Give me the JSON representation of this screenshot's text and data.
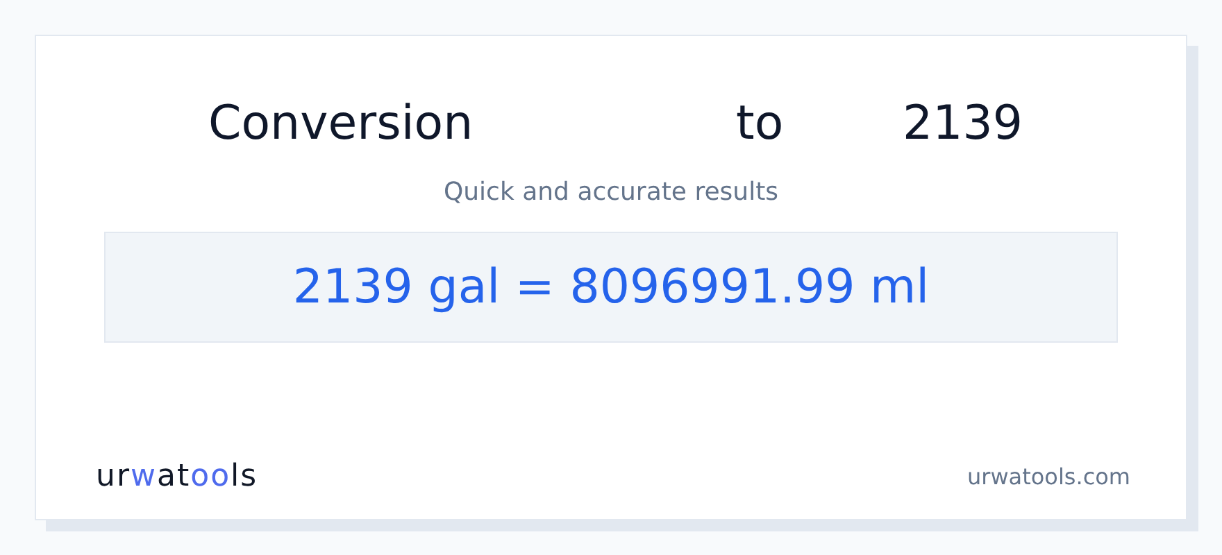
{
  "title": {
    "parts": [
      "Conversion",
      "to",
      "2139"
    ]
  },
  "subtitle": "Quick and accurate results",
  "result": "2139 gal = 8096991.99 ml",
  "logo": [
    {
      "text": "ur",
      "accent": false
    },
    {
      "text": "w",
      "accent": true
    },
    {
      "text": "at",
      "accent": false
    },
    {
      "text": "oo",
      "accent": true
    },
    {
      "text": "ls",
      "accent": false
    }
  ],
  "site": "urwatools.com"
}
